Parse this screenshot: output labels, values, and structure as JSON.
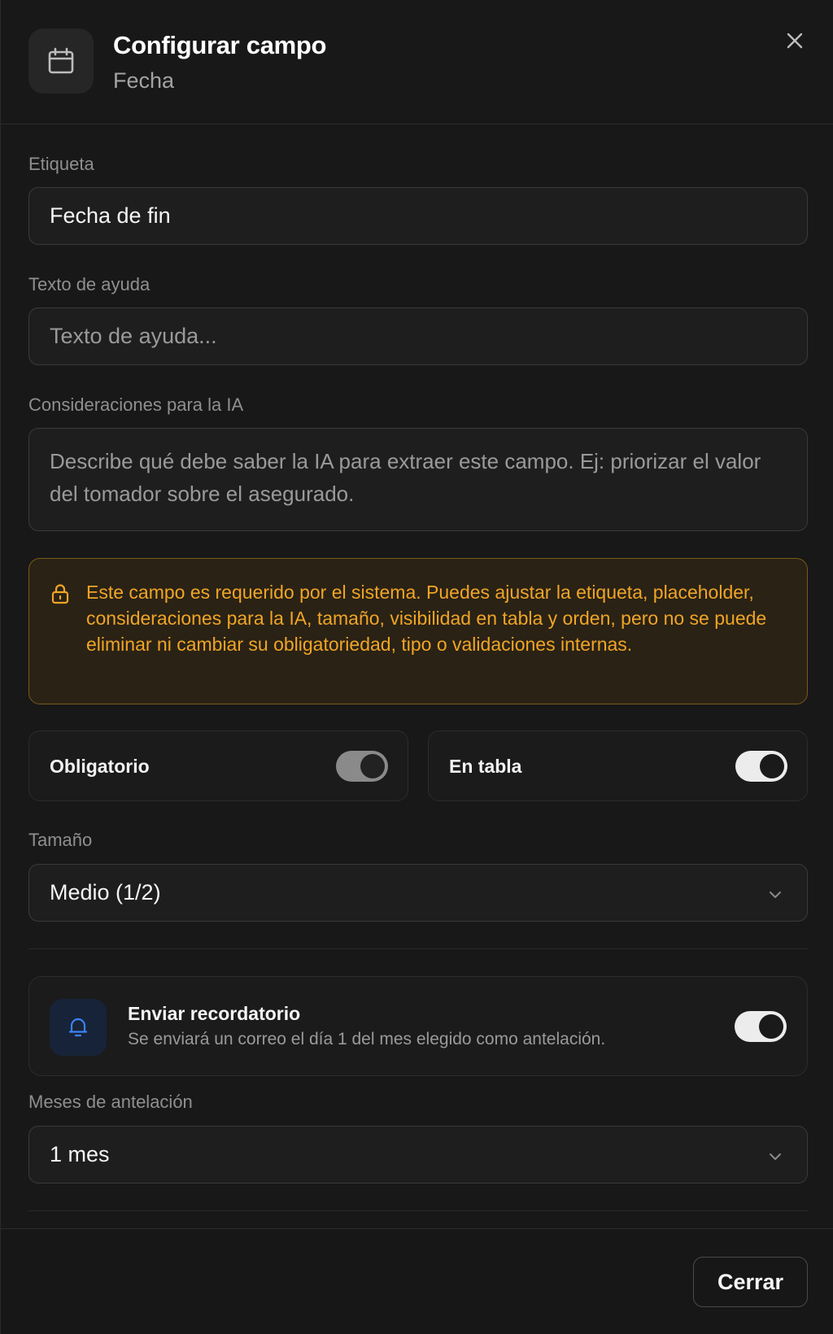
{
  "header": {
    "title": "Configurar campo",
    "subtitle": "Fecha",
    "icon": "calendar-icon",
    "close_icon": "close-icon"
  },
  "fields": {
    "label": {
      "label": "Etiqueta",
      "value": "Fecha de fin"
    },
    "help_text": {
      "label": "Texto de ayuda",
      "placeholder": "Texto de ayuda..."
    },
    "ai_considerations": {
      "label": "Consideraciones para la IA",
      "placeholder": "Describe qué debe saber la IA para extraer este campo. Ej: priorizar el valor del tomador sobre el asegurado."
    }
  },
  "warning": {
    "icon": "lock-icon",
    "text": "Este campo es requerido por el sistema. Puedes ajustar la etiqueta, placeholder, consideraciones para la IA, tamaño, visibilidad en tabla y orden, pero no se puede eliminar ni cambiar su obligatoriedad, tipo o validaciones internas.",
    "color": "#f0a526"
  },
  "toggles": {
    "required": {
      "label": "Obligatorio",
      "on": true,
      "disabled": true
    },
    "in_table": {
      "label": "En tabla",
      "on": true,
      "disabled": false
    }
  },
  "size": {
    "label": "Tamaño",
    "value": "Medio (1/2)"
  },
  "reminder": {
    "icon": "bell-icon",
    "title": "Enviar recordatorio",
    "description": "Se enviará un correo el día 1 del mes elegido como antelación.",
    "on": true
  },
  "advance_months": {
    "label": "Meses de antelación",
    "value": "1 mes"
  },
  "footer": {
    "close_label": "Cerrar"
  }
}
